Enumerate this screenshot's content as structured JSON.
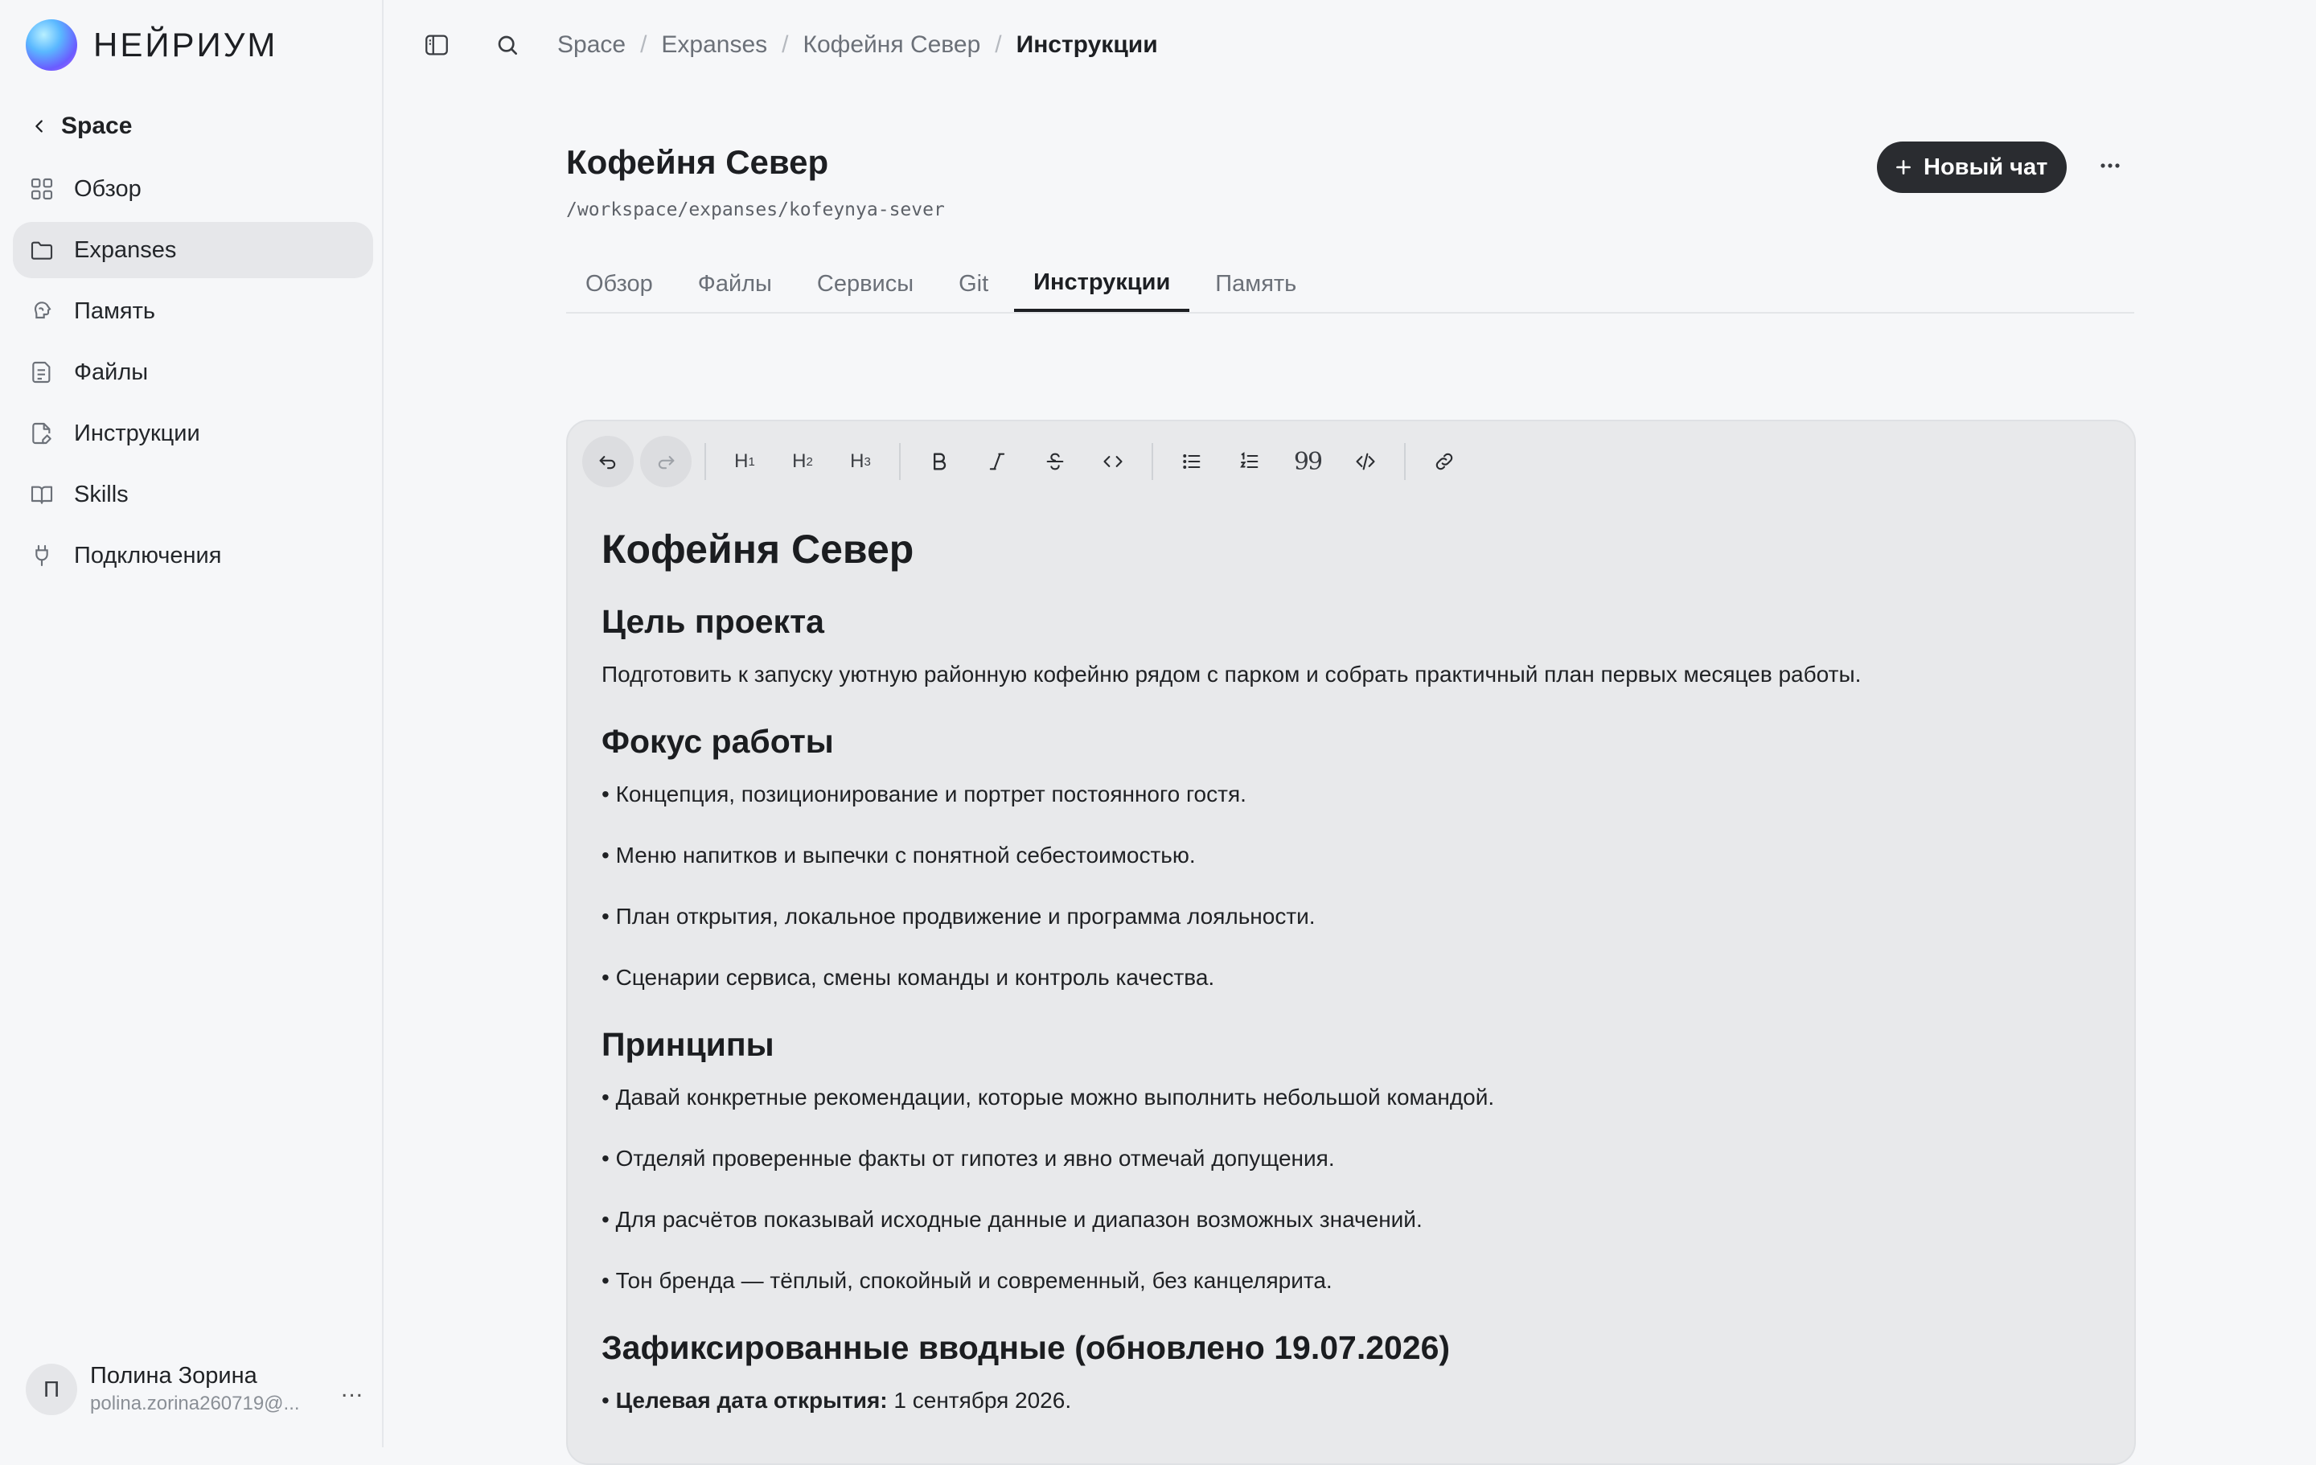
{
  "brand": {
    "name": "НЕЙРИУМ"
  },
  "sidebar": {
    "back_label": "Space",
    "items": [
      {
        "label": "Обзор",
        "icon": "grid-icon"
      },
      {
        "label": "Expanses",
        "icon": "folder-icon",
        "active": true
      },
      {
        "label": "Память",
        "icon": "brain-icon"
      },
      {
        "label": "Файлы",
        "icon": "file-icon"
      },
      {
        "label": "Инструкции",
        "icon": "document-edit-icon"
      },
      {
        "label": "Skills",
        "icon": "book-icon"
      },
      {
        "label": "Подключения",
        "icon": "plug-icon"
      }
    ],
    "user": {
      "initial": "П",
      "name": "Полина Зорина",
      "email": "polina.zorina260719@...",
      "more": "..."
    }
  },
  "header": {
    "breadcrumbs": [
      "Space",
      "Expanses",
      "Кофейня Север",
      "Инструкции"
    ]
  },
  "project": {
    "title": "Кофейня Север",
    "path": "/workspace/expanses/kofeynya-sever",
    "new_chat_label": "Новый чат"
  },
  "tabs": [
    "Обзор",
    "Файлы",
    "Сервисы",
    "Git",
    "Инструкции",
    "Память"
  ],
  "active_tab": "Инструкции",
  "toolbar": {
    "h1": "H",
    "h1_sub": "1",
    "h2": "H",
    "h2_sub": "2",
    "h3": "H",
    "h3_sub": "3",
    "quote": "99"
  },
  "document": {
    "title": "Кофейня Север",
    "goal_heading": "Цель проекта",
    "goal_text": "Подготовить к запуску уютную районную кофейню рядом с парком и собрать практичный план первых месяцев работы.",
    "focus_heading": "Фокус работы",
    "focus_items": [
      "• Концепция, позиционирование и портрет постоянного гостя.",
      "• Меню напитков и выпечки с понятной себестоимостью.",
      "• План открытия, локальное продвижение и программа лояльности.",
      "• Сценарии сервиса, смены команды и контроль качества."
    ],
    "principles_heading": "Принципы",
    "principles_items": [
      "• Давай конкретные рекомендации, которые можно выполнить небольшой командой.",
      "• Отделяй проверенные факты от гипотез и явно отмечай допущения.",
      "• Для расчётов показывай исходные данные и диапазон возможных значений.",
      "• Тон бренда — тёплый, спокойный и современный, без канцелярита."
    ],
    "inputs_heading": "Зафиксированные вводные (обновлено 19.07.2026)",
    "inputs_bullet": "•",
    "inputs_label": "Целевая дата открытия:",
    "inputs_value": "1 сентября 2026."
  }
}
